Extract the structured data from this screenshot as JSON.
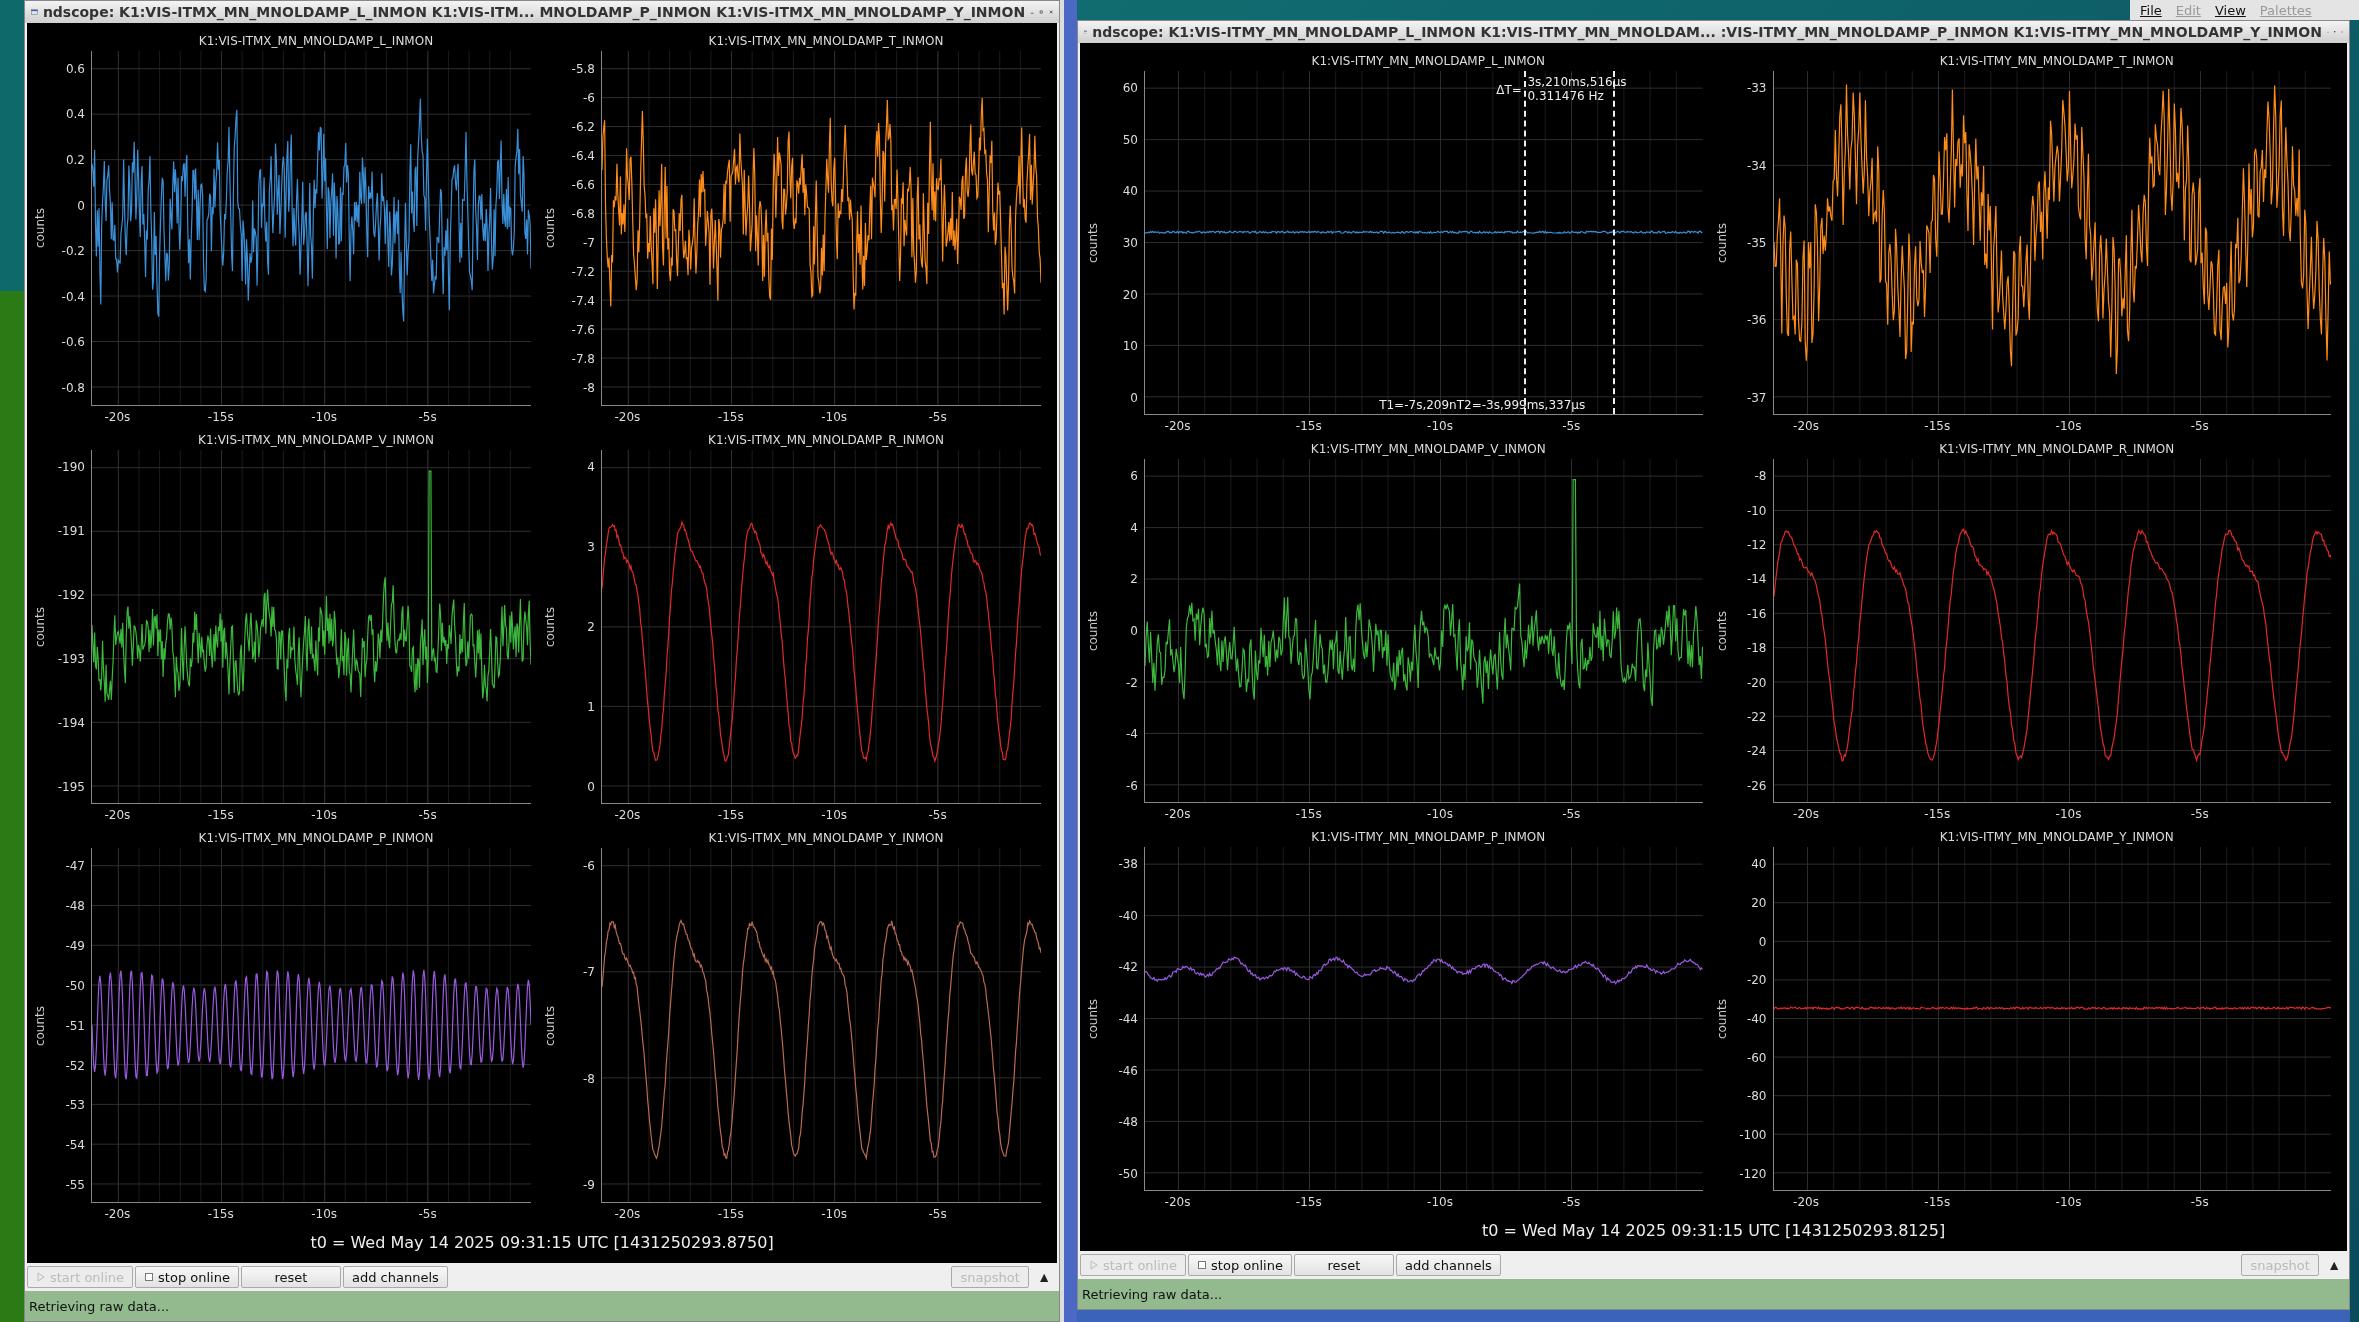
{
  "desktop_menu": [
    {
      "label": "File",
      "disabled": false
    },
    {
      "label": "Edit",
      "disabled": true
    },
    {
      "label": "View",
      "disabled": false
    },
    {
      "label": "Palettes",
      "disabled": true
    }
  ],
  "windows": [
    {
      "title": "ndscope: K1:VIS-ITMX_MN_MNOLDAMP_L_INMON K1:VIS-ITM...  MNOLDAMP_P_INMON K1:VIS-ITMX_MN_MNOLDAMP_Y_INMON",
      "t0": "t0 = Wed May 14 2025 09:31:15 UTC [1431250293.8750]",
      "status": "Retrieving raw data...",
      "expand_toggle": "▲",
      "buttons": [
        {
          "kind": "start",
          "label": "start online",
          "disabled": true
        },
        {
          "kind": "stop",
          "label": "stop online",
          "disabled": false
        },
        {
          "kind": "plain",
          "label": "reset",
          "disabled": false
        },
        {
          "kind": "plain",
          "label": "add channels",
          "disabled": false
        },
        {
          "kind": "snapshot",
          "label": "snapshot",
          "disabled": true
        }
      ],
      "plots": [
        {
          "title": "K1:VIS-ITMX_MN_MNOLDAMP_L_INMON",
          "ylabel": "counts",
          "color": "#3a8fd8",
          "kind": "noise",
          "yticks": [
            "0.6",
            "0.4",
            "0.2",
            "0",
            "-0.2",
            "-0.4",
            "-0.6",
            "-0.8"
          ],
          "xticks": [
            "-20s",
            "-15s",
            "-10s",
            "-5s"
          ]
        },
        {
          "title": "K1:VIS-ITMX_MN_MNOLDAMP_T_INMON",
          "ylabel": "counts",
          "color": "#ff8c1a",
          "kind": "noise",
          "yticks": [
            "-5.8",
            "-6",
            "-6.2",
            "-6.4",
            "-6.6",
            "-6.8",
            "-7",
            "-7.2",
            "-7.4",
            "-7.6",
            "-7.8",
            "-8"
          ],
          "xticks": [
            "-20s",
            "-15s",
            "-10s",
            "-5s"
          ]
        },
        {
          "title": "K1:VIS-ITMX_MN_MNOLDAMP_V_INMON",
          "ylabel": "counts",
          "color": "#3cb83c",
          "kind": "noise-spike",
          "yticks": [
            "-190",
            "-191",
            "-192",
            "-193",
            "-194",
            "-195"
          ],
          "xticks": [
            "-20s",
            "-15s",
            "-10s",
            "-5s"
          ]
        },
        {
          "title": "K1:VIS-ITMX_MN_MNOLDAMP_R_INMON",
          "ylabel": "counts",
          "color": "#e02a2a",
          "kind": "smooth-oscillation",
          "yticks": [
            "4",
            "3",
            "2",
            "1",
            "0"
          ],
          "xticks": [
            "-20s",
            "-15s",
            "-10s",
            "-5s"
          ]
        },
        {
          "title": "K1:VIS-ITMX_MN_MNOLDAMP_P_INMON",
          "ylabel": "counts",
          "color": "#9a5ae0",
          "kind": "fast-oscillation",
          "yticks": [
            "-47",
            "-48",
            "-49",
            "-50",
            "-51",
            "-52",
            "-53",
            "-54",
            "-55"
          ],
          "xticks": [
            "-20s",
            "-15s",
            "-10s",
            "-5s"
          ]
        },
        {
          "title": "K1:VIS-ITMX_MN_MNOLDAMP_Y_INMON",
          "ylabel": "counts",
          "color": "#b86a52",
          "kind": "smooth-oscillation",
          "yticks": [
            "-6",
            "-7",
            "-8",
            "-9"
          ],
          "xticks": [
            "-20s",
            "-15s",
            "-10s",
            "-5s"
          ]
        }
      ]
    },
    {
      "title": "ndscope: K1:VIS-ITMY_MN_MNOLDAMP_L_INMON K1:VIS-ITMY_MN_MNOLDAM... :VIS-ITMY_MN_MNOLDAMP_P_INMON K1:VIS-ITMY_MN_MNOLDAMP_Y_INMON",
      "t0": "t0 = Wed May 14 2025 09:31:15 UTC [1431250293.8125]",
      "status": "Retrieving raw data...",
      "expand_toggle": "▲",
      "buttons": [
        {
          "kind": "start",
          "label": "start online",
          "disabled": true
        },
        {
          "kind": "stop",
          "label": "stop online",
          "disabled": false
        },
        {
          "kind": "plain",
          "label": "reset",
          "disabled": false
        },
        {
          "kind": "plain",
          "label": "add channels",
          "disabled": false
        },
        {
          "kind": "snapshot",
          "label": "snapshot",
          "disabled": true
        }
      ],
      "plots": [
        {
          "title": "K1:VIS-ITMY_MN_MNOLDAMP_L_INMON",
          "ylabel": "counts",
          "color": "#3a8fd8",
          "kind": "flat",
          "yticks": [
            "60",
            "50",
            "40",
            "30",
            "20",
            "10",
            "0"
          ],
          "xticks": [
            "-20s",
            "-15s",
            "-10s",
            "-5s"
          ],
          "cursor": {
            "delta_label": "ΔT=",
            "delta": "3s,210ms,516µs",
            "frequency": "0.311476 Hz",
            "t1": "T1=-7s,209n",
            "t2": "T2=-3s,999ms,337µs"
          }
        },
        {
          "title": "K1:VIS-ITMY_MN_MNOLDAMP_T_INMON",
          "ylabel": "counts",
          "color": "#ff8c1a",
          "kind": "noisy-oscillation",
          "yticks": [
            "-33",
            "-34",
            "-35",
            "-36",
            "-37"
          ],
          "xticks": [
            "-20s",
            "-15s",
            "-10s",
            "-5s"
          ]
        },
        {
          "title": "K1:VIS-ITMY_MN_MNOLDAMP_V_INMON",
          "ylabel": "counts",
          "color": "#3cb83c",
          "kind": "noise-spike",
          "yticks": [
            "6",
            "4",
            "2",
            "0",
            "-2",
            "-4",
            "-6"
          ],
          "xticks": [
            "-20s",
            "-15s",
            "-10s",
            "-5s"
          ]
        },
        {
          "title": "K1:VIS-ITMY_MN_MNOLDAMP_R_INMON",
          "ylabel": "counts",
          "color": "#e02a2a",
          "kind": "smooth-oscillation",
          "yticks": [
            "-8",
            "-10",
            "-12",
            "-14",
            "-16",
            "-18",
            "-20",
            "-22",
            "-24",
            "-26"
          ],
          "xticks": [
            "-20s",
            "-15s",
            "-10s",
            "-5s"
          ]
        },
        {
          "title": "K1:VIS-ITMY_MN_MNOLDAMP_P_INMON",
          "ylabel": "counts",
          "color": "#9a5ae0",
          "kind": "drift",
          "yticks": [
            "-38",
            "-40",
            "-42",
            "-44",
            "-46",
            "-48",
            "-50"
          ],
          "xticks": [
            "-20s",
            "-15s",
            "-10s",
            "-5s"
          ]
        },
        {
          "title": "K1:VIS-ITMY_MN_MNOLDAMP_Y_INMON",
          "ylabel": "counts",
          "color": "#e02a2a",
          "kind": "flat",
          "yticks": [
            "40",
            "20",
            "0",
            "-20",
            "-40",
            "-60",
            "-80",
            "-100",
            "-120"
          ],
          "xticks": [
            "-20s",
            "-15s",
            "-10s",
            "-5s"
          ]
        }
      ]
    }
  ]
}
